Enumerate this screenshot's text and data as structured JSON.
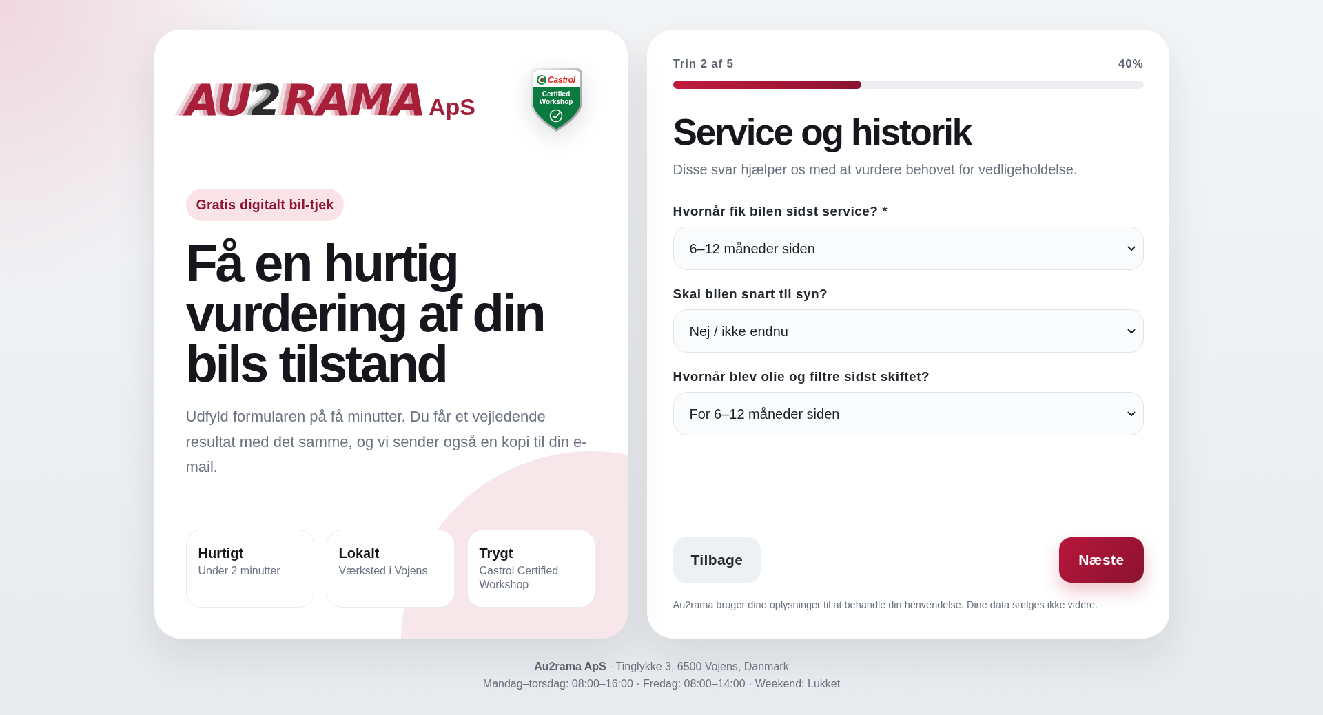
{
  "hero": {
    "logo": {
      "words": [
        {
          "parts": [
            {
              "text": "AU",
              "color": "#a81f3a"
            },
            {
              "text": "2",
              "color": "#2a2a2c"
            }
          ]
        },
        {
          "parts": [
            {
              "text": "RAMA",
              "color": "#a81f3a"
            }
          ]
        }
      ],
      "suffix": "ApS"
    },
    "certification_badge": {
      "brand": "Castrol",
      "caption": "Certified Workshop"
    },
    "tag": "Gratis digitalt bil-tjek",
    "headline": "Få en hurtig vurdering af din bils tilstand",
    "description": "Udfyld formularen på få minutter. Du får et vejledende resultat med det samme, og vi sender også en kopi til din e-mail.",
    "features": [
      {
        "title": "Hurtigt",
        "subtitle": "Under 2 minutter"
      },
      {
        "title": "Lokalt",
        "subtitle": "Værksted i Vojens"
      },
      {
        "title": "Trygt",
        "subtitle": "Castrol Certified Workshop"
      }
    ]
  },
  "form": {
    "progress": {
      "step_label": "Trin 2 af 5",
      "percent_label": "40%",
      "level": 0.4
    },
    "title": "Service og historik",
    "description": "Disse svar hjælper os med at vurdere behovet for vedligeholdelse.",
    "fields": [
      {
        "label": "Hvornår fik bilen sidst service? *",
        "value": "6–12 måneder siden"
      },
      {
        "label": "Skal bilen snart til syn?",
        "value": "Nej / ikke endnu"
      },
      {
        "label": "Hvornår blev olie og filtre sidst skiftet?",
        "value": "For 6–12 måneder siden"
      }
    ],
    "buttons": [
      {
        "kind": "secondary",
        "label": "Tilbage"
      },
      {
        "kind": "primary",
        "label": "Næste"
      }
    ],
    "privacy_note": "Au2rama bruger dine oplysninger til at behandle din henvendelse. Dine data sælges ikke videre."
  },
  "footer": {
    "address": "**Au2rama ApS** · Tinglykke 3, 6500 Vojens, Danmark",
    "hours": "Mandag–torsdag: 08:00–16:00 · Fredag: 08:00–14:00 · Weekend: Lukket"
  }
}
